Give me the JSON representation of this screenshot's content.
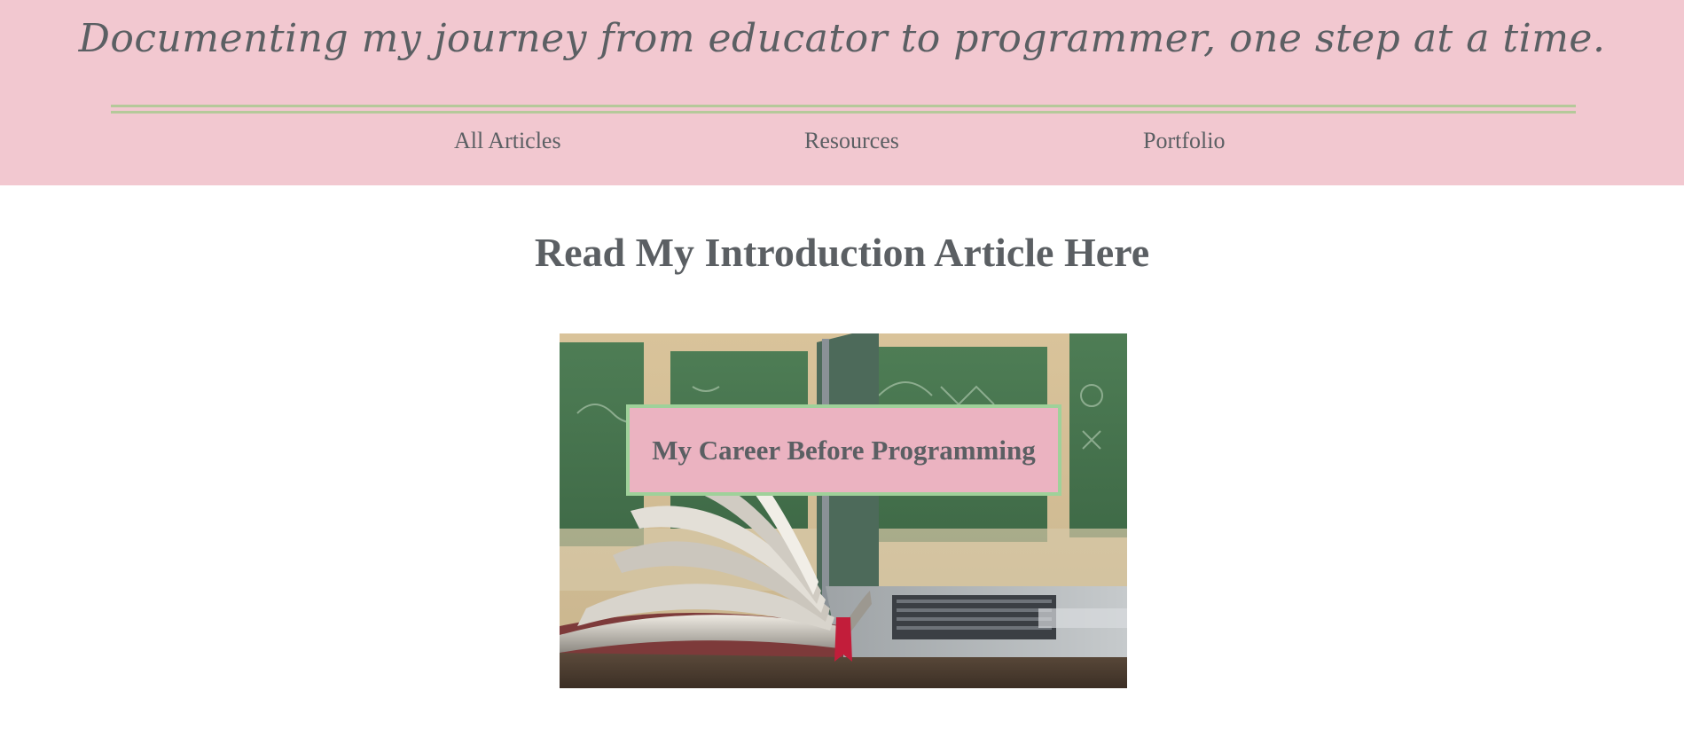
{
  "header": {
    "tagline": "Documenting my journey from educator to programmer, one step at a time.",
    "background_color": "#f2c8d0",
    "divider_color": "#b5c99a"
  },
  "nav": {
    "items": [
      {
        "label": "All Articles"
      },
      {
        "label": "Resources"
      },
      {
        "label": "Portfolio"
      }
    ]
  },
  "main": {
    "heading": "Read My Introduction Article Here",
    "featured": {
      "title": "My Career Before Programming",
      "image_icon": "book-and-laptop-image",
      "label_background": "#ebb3c1",
      "label_border": "#9fd19a"
    }
  },
  "colors": {
    "text": "#5b5f63",
    "page_background": "#ffffff"
  }
}
